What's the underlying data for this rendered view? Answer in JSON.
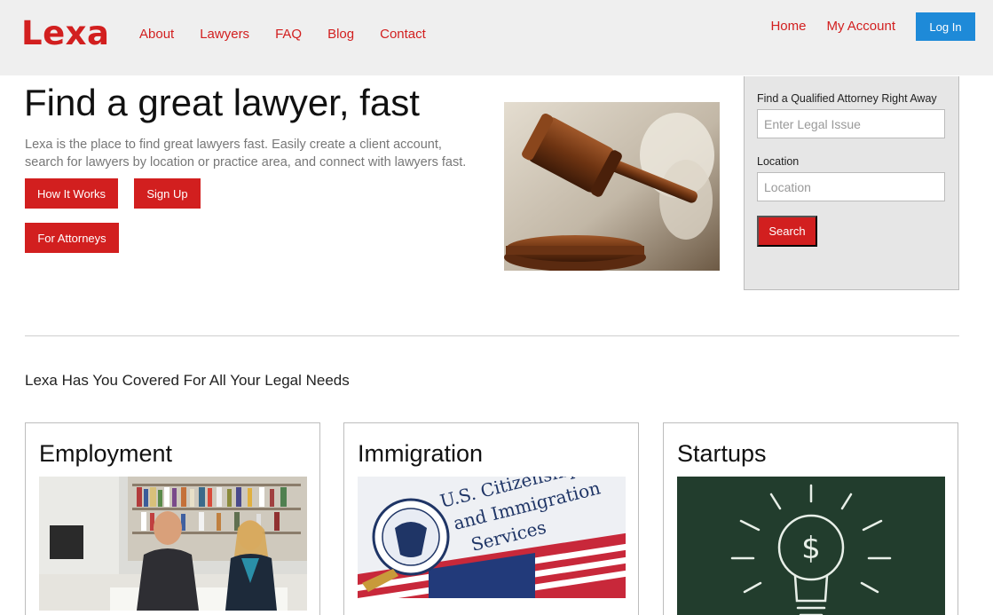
{
  "header": {
    "logo": "Lexa",
    "nav_left": [
      "About",
      "Lawyers",
      "FAQ",
      "Blog",
      "Contact"
    ],
    "nav_right": [
      "Home",
      "My Account"
    ],
    "login_label": "Log In"
  },
  "hero": {
    "title": "Find a great lawyer, fast",
    "description": "Lexa is the place to find great lawyers fast. Easily create a client account, search for lawyers by location or practice area, and connect with lawyers fast.",
    "buttons": {
      "how": "How It Works",
      "signup": "Sign Up",
      "attorneys": "For Attorneys"
    }
  },
  "search": {
    "issue_label": "Find a Qualified Attorney Right Away",
    "issue_placeholder": "Enter Legal Issue",
    "location_label": "Location",
    "location_placeholder": "Location",
    "button": "Search"
  },
  "section": {
    "title": "Lexa Has You Covered For All Your Legal Needs"
  },
  "cards": [
    {
      "title": "Employment"
    },
    {
      "title": "Immigration",
      "image_text": [
        "U.S. Citizenship",
        "and Immigration",
        "Services"
      ]
    },
    {
      "title": "Startups",
      "image_symbol": "$"
    }
  ],
  "colors": {
    "brand_red": "#d21f1f",
    "login_blue": "#1e8ad8",
    "header_bg": "#efefef",
    "panel_bg": "#e6e6e6"
  }
}
